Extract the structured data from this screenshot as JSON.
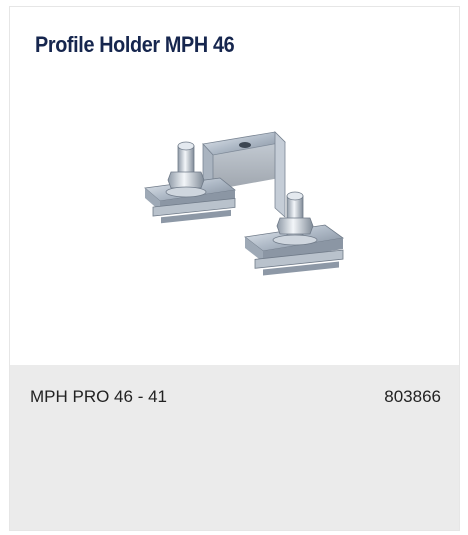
{
  "card": {
    "title": "Profile Holder MPH 46",
    "image_icon": "metal-profile-holder-bracket",
    "variant": {
      "name": "MPH PRO 46 - 41",
      "article_number": "803866"
    }
  },
  "colors": {
    "title": "#16264e",
    "bottom_panel": "#ebebeb",
    "text": "#222222"
  }
}
